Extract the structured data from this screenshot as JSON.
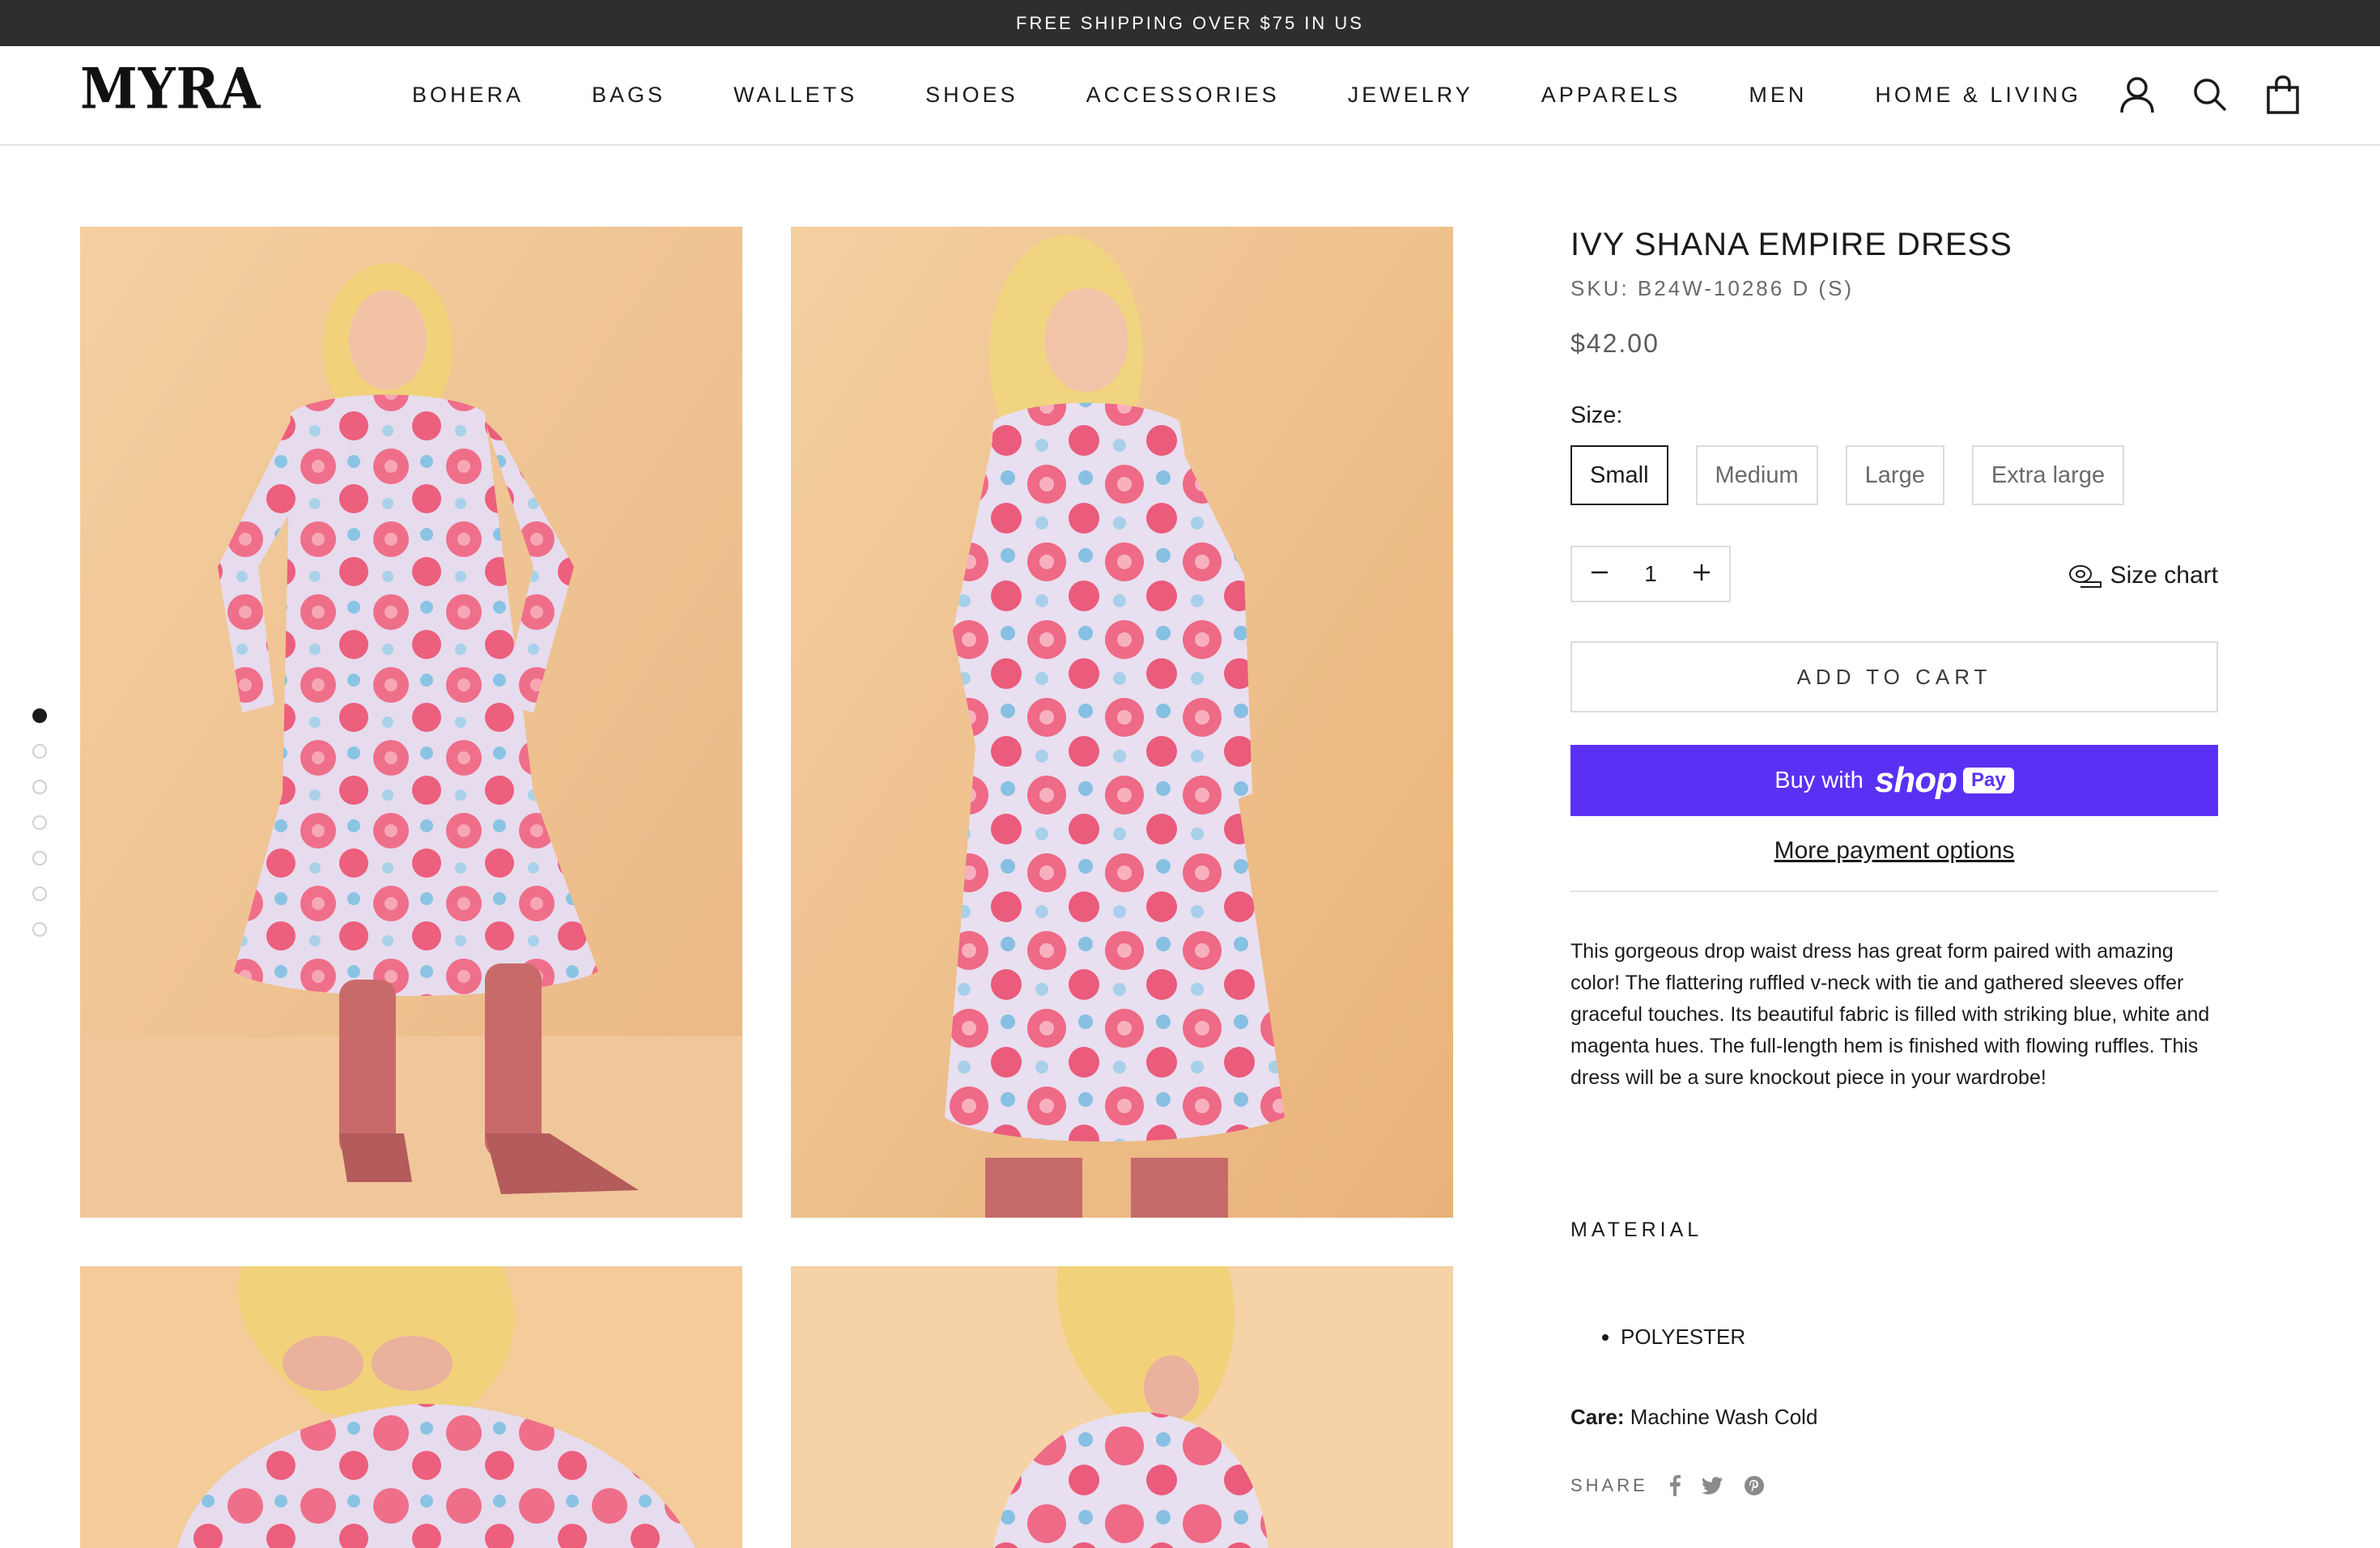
{
  "announcement": "FREE SHIPPING OVER $75 IN US",
  "header": {
    "logo": "MYRA",
    "nav": [
      "BOHERA",
      "BAGS",
      "WALLETS",
      "SHOES",
      "ACCESSORIES",
      "JEWELRY",
      "APPARELS",
      "MEN",
      "HOME & LIVING"
    ],
    "icons": [
      "account-icon",
      "search-icon",
      "cart-icon"
    ]
  },
  "gallery": {
    "dots_count": 7,
    "active_dot": 1,
    "photos": [
      "dress-front-view",
      "dress-side-view",
      "dress-detail-left",
      "dress-detail-right"
    ]
  },
  "product": {
    "title": "IVY SHANA EMPIRE DRESS",
    "sku": "SKU: B24W-10286 D (S)",
    "price": "$42.00",
    "size_label": "Size:",
    "sizes": [
      "Small",
      "Medium",
      "Large",
      "Extra large"
    ],
    "selected_size": "Small",
    "quantity": "1",
    "size_chart": "Size chart",
    "add_to_cart": "ADD TO CART",
    "buy_with": "Buy with",
    "shop_brand": "shop",
    "shop_pay": "Pay",
    "more_payment": "More payment options",
    "description": "This gorgeous drop waist dress has great form paired with amazing color! The flattering ruffled v-neck with tie and gathered sleeves offer graceful touches. Its beautiful fabric is filled with striking blue, white and magenta hues. The full-length hem is finished with flowing ruffles. This dress will be a sure knockout piece in your wardrobe!",
    "material_heading": "MATERIAL",
    "materials": [
      "POLYESTER"
    ],
    "care_label": "Care:",
    "care_value": "Machine Wash Cold",
    "share_label": "SHARE"
  },
  "colors": {
    "announcement_bg": "#2e2e2e",
    "shop_pay": "#5a31f4",
    "photo_bg": "#f3cc9a",
    "dress_pink": "#ee6a86",
    "dress_light": "#e9dbeb"
  }
}
